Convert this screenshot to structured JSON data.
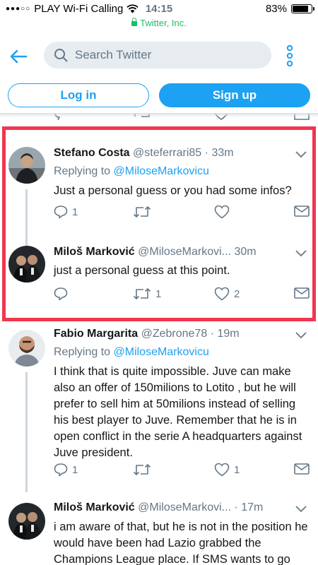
{
  "status_bar": {
    "carrier": "PLAY Wi-Fi Calling",
    "time": "14:15",
    "battery": "83%",
    "battery_level": 0.83,
    "url": "Twitter, Inc."
  },
  "header": {
    "search_placeholder": "Search Twitter",
    "login_label": "Log in",
    "signup_label": "Sign up"
  },
  "tweets": [
    {
      "name": "Stefano Costa",
      "handle": "@steferrari85",
      "time": "33m",
      "reply_prefix": "Replying to",
      "reply_to": "@MiloseMarkovicu",
      "text": "Just a personal guess or you had some infos?",
      "replies": "1",
      "retweets": "",
      "likes": ""
    },
    {
      "name": "Miloš Marković",
      "handle": "@MiloseMarkovi...",
      "time": "30m",
      "text": "just a personal guess at this point.",
      "replies": "",
      "retweets": "1",
      "likes": "2"
    },
    {
      "name": "Fabio Margarita",
      "handle": "@Zebrone78",
      "time": "19m",
      "reply_prefix": "Replying to",
      "reply_to": "@MiloseMarkovicu",
      "text": "I think that is quite impossible. Juve can make also an offer of 150milions to Lotito , but he will prefer to sell him at 50milions instead of selling his best player to Juve. Remember that he is in open conflict in the serie A headquarters against Juve president.",
      "replies": "1",
      "retweets": "",
      "likes": "1"
    },
    {
      "name": "Miloš Marković",
      "handle": "@MiloseMarkovi...",
      "time": "17m",
      "text": "i am aware of that, but he is not in the position he would have been had Lazio grabbed the Champions League place. If SMS wants to go"
    }
  ],
  "colors": {
    "accent": "#1da1f2",
    "highlight_border": "#f1364f",
    "secure": "#17bf63",
    "secondary_text": "#657786"
  }
}
